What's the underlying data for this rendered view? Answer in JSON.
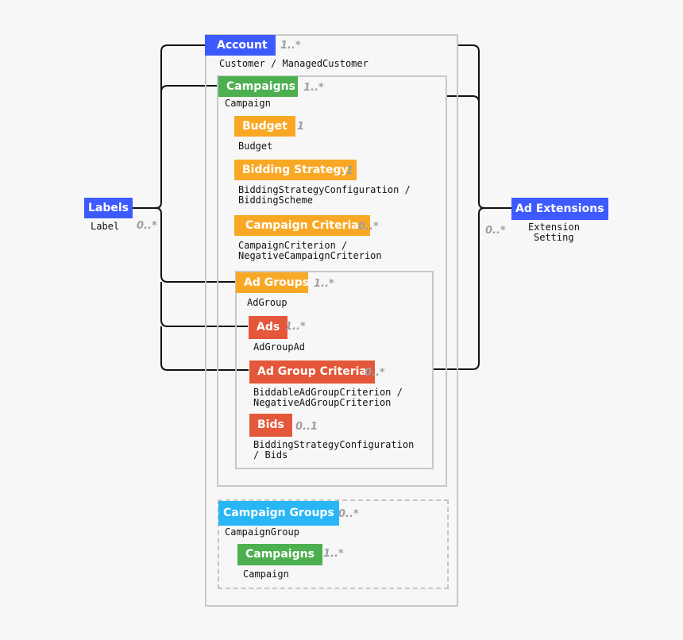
{
  "colors": {
    "blue": "#3d5afe",
    "green": "#4caf50",
    "orange": "#f9a825",
    "red": "#e4573a",
    "cyan": "#29b6f6",
    "background": "#f7f7f7"
  },
  "account": {
    "label": "Account",
    "multiplicity": "1..*",
    "class": "Customer / ManagedCustomer"
  },
  "campaigns": {
    "label": "Campaigns",
    "multiplicity": "1..*",
    "class": "Campaign"
  },
  "budget": {
    "label": "Budget",
    "multiplicity": "1",
    "class": "Budget"
  },
  "bidding_strategy": {
    "label": "Bidding Strategy",
    "multiplicity": "1",
    "class_line1": "BiddingStrategyConfiguration /",
    "class_line2": "BiddingScheme"
  },
  "campaign_criteria": {
    "label": "Campaign Criteria",
    "multiplicity": "0..*",
    "class_line1": "CampaignCriterion /",
    "class_line2": "NegativeCampaignCriterion"
  },
  "ad_groups": {
    "label": "Ad Groups",
    "multiplicity": "1..*",
    "class": "AdGroup"
  },
  "ads": {
    "label": "Ads",
    "multiplicity": "1..*",
    "class": "AdGroupAd"
  },
  "ad_group_criteria": {
    "label": "Ad Group Criteria",
    "multiplicity": "0..*",
    "class_line1": "BiddableAdGroupCriterion /",
    "class_line2": "NegativeAdGroupCriterion"
  },
  "bids": {
    "label": "Bids",
    "multiplicity": "0..1",
    "class_line1": "BiddingStrategyConfiguration",
    "class_line2": "/ Bids"
  },
  "campaign_groups": {
    "label": "Campaign Groups",
    "multiplicity": "0..*",
    "class": "CampaignGroup"
  },
  "campaign_groups_campaigns": {
    "label": "Campaigns",
    "multiplicity": "1..*",
    "class": "Campaign"
  },
  "labels": {
    "label": "Labels",
    "multiplicity": "0..*",
    "class": "Label"
  },
  "ad_extensions": {
    "label": "Ad Extensions",
    "multiplicity": "0..*",
    "class_line1": "Extension",
    "class_line2": "Setting"
  }
}
